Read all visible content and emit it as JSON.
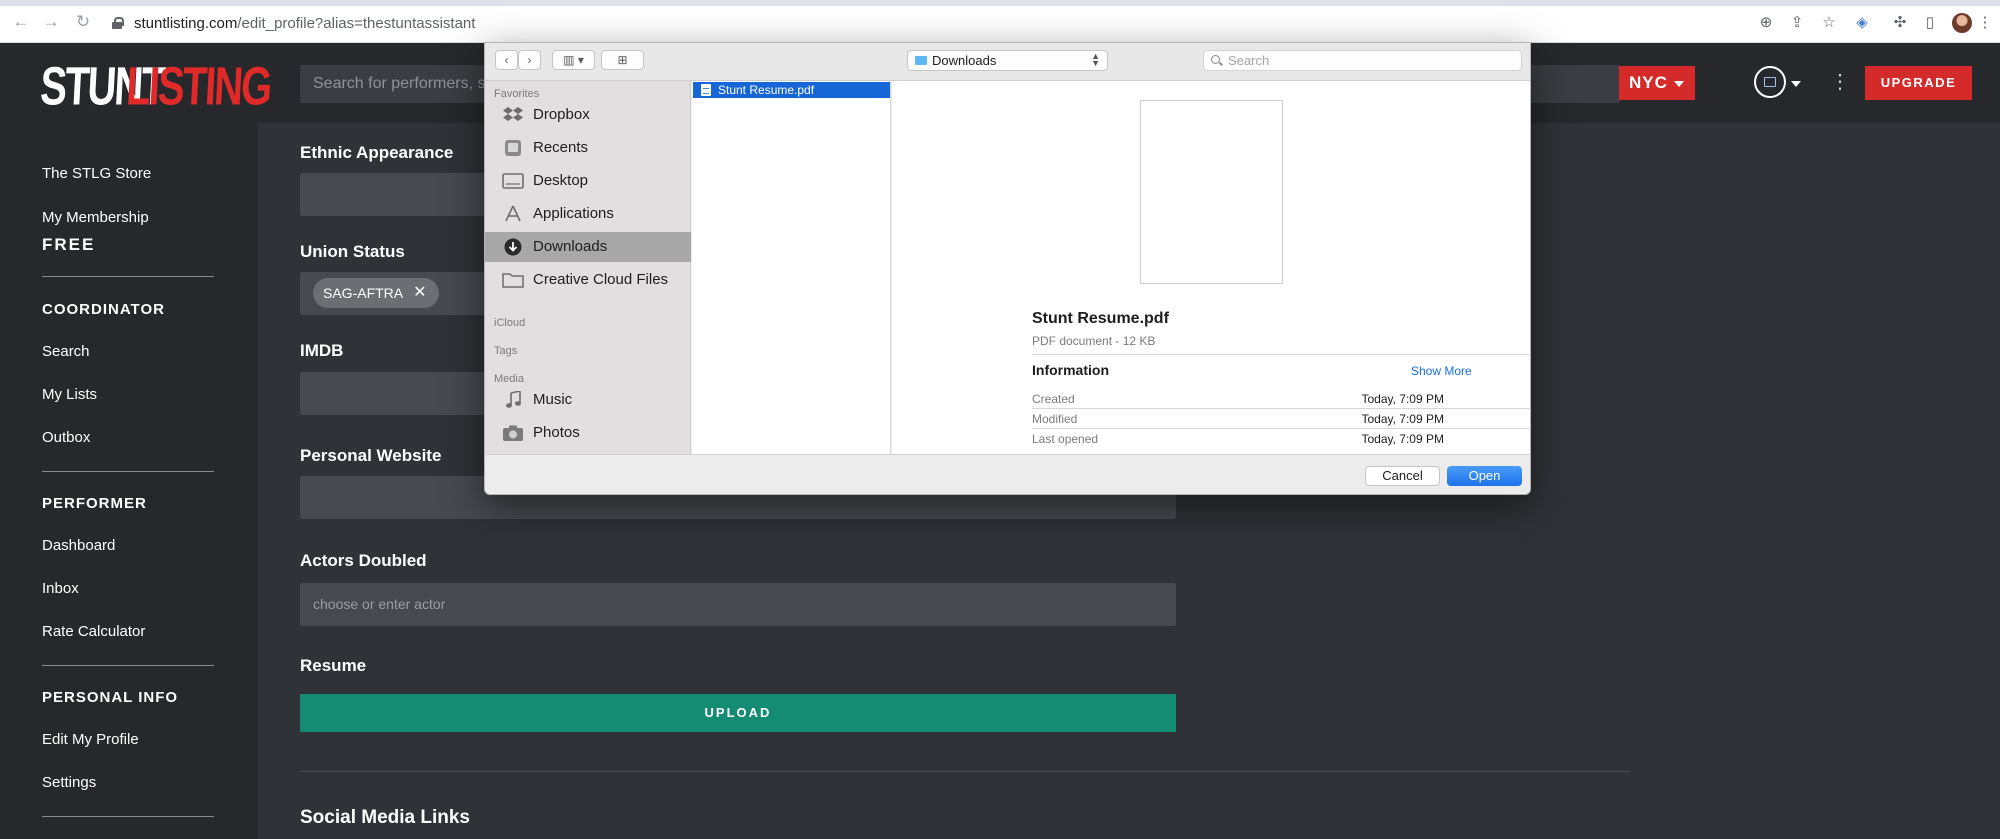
{
  "browser": {
    "url_host": "stuntlisting.com",
    "url_path": "/edit_profile?alias=thestuntassistant"
  },
  "header": {
    "logo_part1": "STUNT",
    "logo_part2": "LISTING",
    "search_placeholder": "Search for performers, sk",
    "city": "NYC",
    "upgrade": "UPGRADE"
  },
  "sidebar": {
    "store": "The STLG Store",
    "membership": "My Membership",
    "membership_tier": "FREE",
    "coordinator_heading": "COORDINATOR",
    "coordinator_items": [
      "Search",
      "My Lists",
      "Outbox"
    ],
    "performer_heading": "PERFORMER",
    "performer_items": [
      "Dashboard",
      "Inbox",
      "Rate Calculator"
    ],
    "personal_heading": "PERSONAL INFO",
    "personal_items": [
      "Edit My Profile",
      "Settings"
    ]
  },
  "form": {
    "ethnic_label": "Ethnic Appearance",
    "union_label": "Union Status",
    "union_chip": "SAG-AFTRA",
    "imdb_label": "IMDB",
    "website_label": "Personal Website",
    "actors_label": "Actors Doubled",
    "actors_placeholder": "choose or enter actor",
    "resume_label": "Resume",
    "upload": "UPLOAD",
    "social_title": "Social Media Links"
  },
  "dialog": {
    "location": "Downloads",
    "search_placeholder": "Search",
    "favorites_label": "Favorites",
    "favorites": [
      "Dropbox",
      "Recents",
      "Desktop",
      "Applications",
      "Downloads",
      "Creative Cloud Files"
    ],
    "icloud_label": "iCloud",
    "tags_label": "Tags",
    "media_label": "Media",
    "media": [
      "Music",
      "Photos"
    ],
    "selected_file": "Stunt Resume.pdf",
    "preview": {
      "name": "Stunt Resume.pdf",
      "kind": "PDF document - 12 KB",
      "info_title": "Information",
      "show_more": "Show More",
      "created_label": "Created",
      "created_value": "Today, 7:09 PM",
      "modified_label": "Modified",
      "modified_value": "Today, 7:09 PM",
      "opened_label": "Last opened",
      "opened_value": "Today, 7:09 PM"
    },
    "cancel": "Cancel",
    "open": "Open"
  }
}
